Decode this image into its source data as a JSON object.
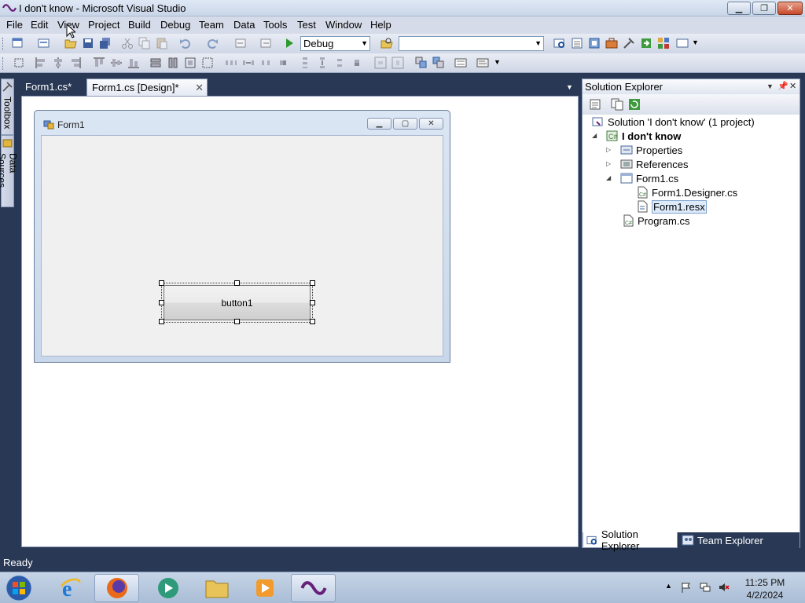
{
  "window": {
    "title": "I don't know - Microsoft Visual Studio",
    "minimize": "▁",
    "restore": "❐",
    "close": "✕"
  },
  "menu": [
    "File",
    "Edit",
    "View",
    "Project",
    "Build",
    "Debug",
    "Team",
    "Data",
    "Tools",
    "Test",
    "Window",
    "Help"
  ],
  "toolbar": {
    "configuration": "Debug",
    "find_value": ""
  },
  "left_dock": {
    "toolbox": "Toolbox",
    "data_sources": "Data Sources"
  },
  "doc_tabs": [
    {
      "label": "Form1.cs*"
    },
    {
      "label": "Form1.cs [Design]*"
    }
  ],
  "designer": {
    "form_title": "Form1",
    "button_text": "button1"
  },
  "solution_explorer": {
    "title": "Solution Explorer",
    "nodes": [
      {
        "label": "Solution 'I don't know' (1 project)"
      },
      {
        "label": "I don't know"
      },
      {
        "label": "Properties"
      },
      {
        "label": "References"
      },
      {
        "label": "Form1.cs"
      },
      {
        "label": "Form1.Designer.cs"
      },
      {
        "label": "Form1.resx"
      },
      {
        "label": "Program.cs"
      }
    ],
    "bottom_tabs": [
      {
        "label": "Solution Explorer"
      },
      {
        "label": "Team Explorer"
      }
    ]
  },
  "status": {
    "text": "Ready"
  },
  "taskbar": {
    "time": "11:25 PM",
    "date": "4/2/2024"
  },
  "colors": {
    "accent": "#293955",
    "selection": "#dceaf9"
  }
}
